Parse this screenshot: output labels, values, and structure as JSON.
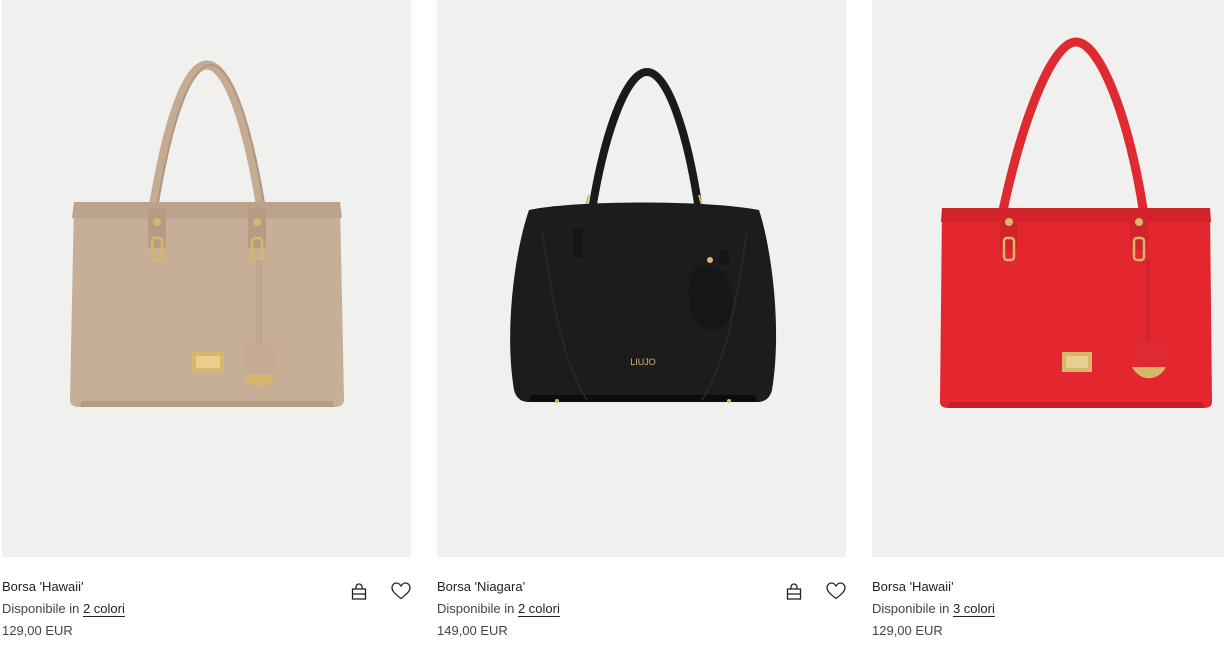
{
  "products": [
    {
      "name": "Borsa 'Hawaii'",
      "availability_prefix": "Disponibile in",
      "colors_link": "2 colori",
      "price": "129,00 EUR",
      "bag_color": "#c7ae96",
      "bag_dark": "#b39a82"
    },
    {
      "name": "Borsa 'Niagara'",
      "availability_prefix": "Disponibile in",
      "colors_link": "2 colori",
      "price": "149,00 EUR",
      "bag_color": "#1c1c1e",
      "bag_dark": "#0c0c0d",
      "logo_text": "LIUJO"
    },
    {
      "name": "Borsa 'Hawaii'",
      "availability_prefix": "Disponibile in",
      "colors_link": "3 colori",
      "price": "129,00 EUR",
      "bag_color": "#e4262e",
      "bag_dark": "#c81d25"
    }
  ],
  "icons": {
    "cart": "shopping-bag-icon",
    "wishlist": "heart-icon"
  },
  "colors": {
    "image_bg": "#f0f0ee",
    "hardware_gold": "#d8b66a"
  }
}
